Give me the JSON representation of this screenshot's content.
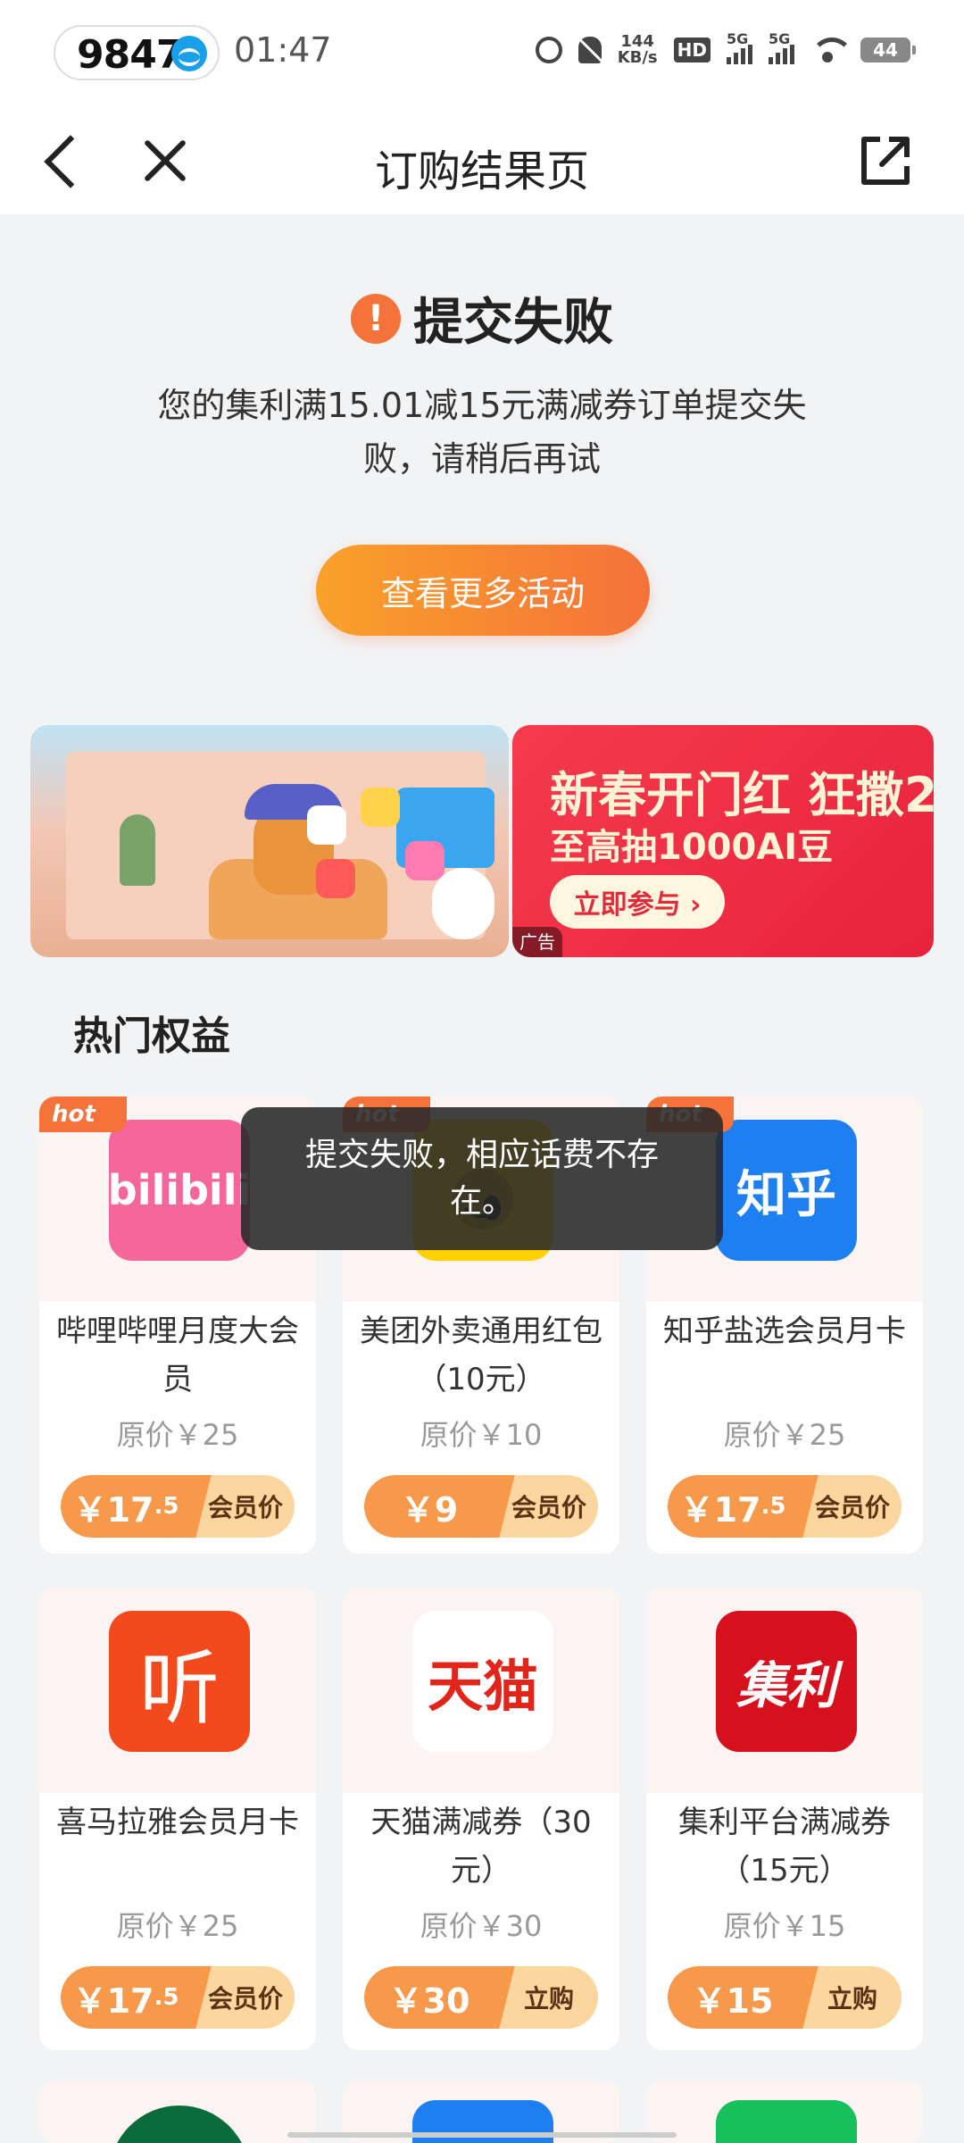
{
  "status_bar": {
    "carrier_number": "9847",
    "time": "01:47",
    "net_speed_value": "144",
    "net_speed_unit": "KB/s",
    "hd_label": "HD",
    "signal1_label": "5G",
    "signal2_label": "5G",
    "battery": "44"
  },
  "nav": {
    "title": "订购结果页"
  },
  "result": {
    "title": "提交失败",
    "description": "您的集利满15.01减15元满减券订单提交失败，请稍后再试",
    "button_label": "查看更多活动"
  },
  "banners": {
    "banner2_title": "新春开门红 狂撒2",
    "banner2_subtitle": "至高抽1000AI豆",
    "banner2_button": "立即参与 ›",
    "ad_label": "广告"
  },
  "section": {
    "title": "热门权益"
  },
  "products": [
    {
      "name": "哔哩哔哩月度大会员",
      "original_price": "原价￥25",
      "price_main": "￥17",
      "price_decimal": ".5",
      "price_label": "会员价",
      "hot": "hot",
      "logo_text": "bilibili",
      "logo_color": "#f5679b"
    },
    {
      "name": "美团外卖通用红包（10元）",
      "original_price": "原价￥10",
      "price_main": "￥9",
      "price_decimal": "",
      "price_label": "会员价",
      "hot": "hot",
      "logo_text": "",
      "logo_color": "#ffd100"
    },
    {
      "name": "知乎盐选会员月卡",
      "original_price": "原价￥25",
      "price_main": "￥17",
      "price_decimal": ".5",
      "price_label": "会员价",
      "hot": "hot",
      "logo_text": "知乎",
      "logo_color": "#1d7ff0"
    },
    {
      "name": "喜马拉雅会员月卡",
      "original_price": "原价￥25",
      "price_main": "￥17",
      "price_decimal": ".5",
      "price_label": "会员价",
      "hot": "",
      "logo_text": "听",
      "logo_color": "#f24a1d"
    },
    {
      "name": "天猫满减券（30元）",
      "original_price": "原价￥30",
      "price_main": "￥30",
      "price_decimal": "",
      "price_label": "立购",
      "hot": "",
      "logo_text": "天猫",
      "logo_color": "#ffffff"
    },
    {
      "name": "集利平台满减券（15元）",
      "original_price": "原价￥15",
      "price_main": "￥15",
      "price_decimal": "",
      "price_label": "立购",
      "hot": "",
      "logo_text": "集利",
      "logo_color": "#d6101c"
    }
  ],
  "toast": {
    "message": "提交失败，相应话费不存在。"
  },
  "colors": {
    "accent": "#f5723a",
    "button_gradient_start": "#f9a12a",
    "price_tag": "#f7984a"
  }
}
